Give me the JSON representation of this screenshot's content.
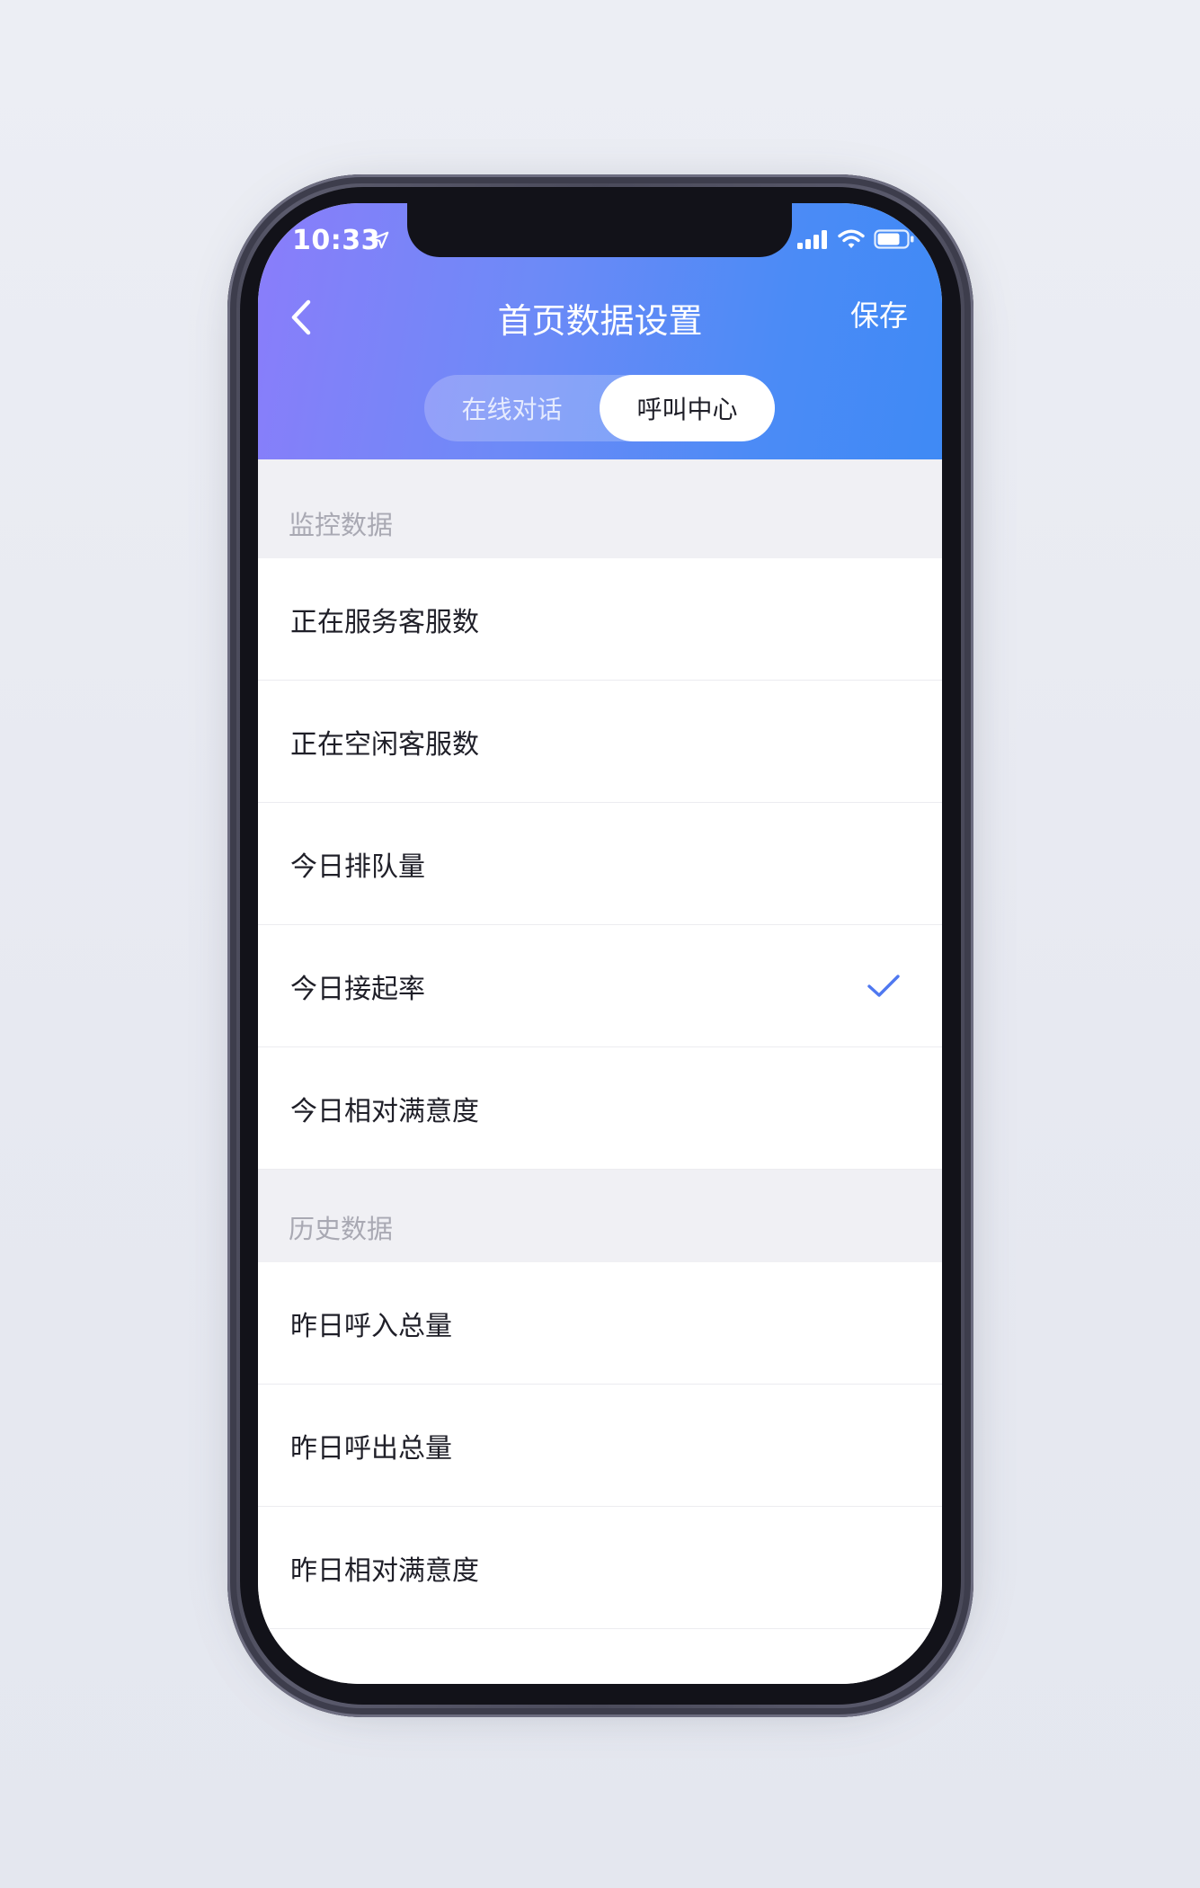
{
  "status_bar": {
    "time": "10:33",
    "icons": [
      "location-arrow-icon",
      "cellular-signal-icon",
      "wifi-icon",
      "battery-icon"
    ]
  },
  "nav": {
    "back_icon": "chevron-left-icon",
    "title": "首页数据设置",
    "save_label": "保存"
  },
  "segment": {
    "tabs": [
      {
        "label": "在线对话",
        "active": false
      },
      {
        "label": "呼叫中心",
        "active": true
      }
    ]
  },
  "sections": [
    {
      "title": "监控数据",
      "items": [
        {
          "label": "正在服务客服数",
          "checked": false
        },
        {
          "label": "正在空闲客服数",
          "checked": false
        },
        {
          "label": "今日排队量",
          "checked": false
        },
        {
          "label": "今日接起率",
          "checked": true
        },
        {
          "label": "今日相对满意度",
          "checked": false
        }
      ]
    },
    {
      "title": "历史数据",
      "items": [
        {
          "label": "昨日呼入总量",
          "checked": false
        },
        {
          "label": "昨日呼出总量",
          "checked": false
        },
        {
          "label": "昨日相对满意度",
          "checked": false
        }
      ]
    }
  ],
  "colors": {
    "header_gradient_start": "#8a7dfa",
    "header_gradient_end": "#3f8af5",
    "check_color": "#4f78f0",
    "section_text": "#a9a9b3",
    "item_text": "#1f1f28"
  }
}
